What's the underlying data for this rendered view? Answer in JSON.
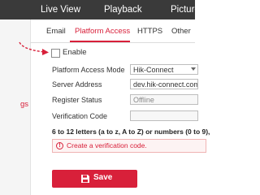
{
  "topbar": {
    "items": [
      "Live View",
      "Playback",
      "Picture"
    ],
    "background": "#3a3a3a"
  },
  "sidebar": {
    "active_item_label": "gs"
  },
  "tabs": {
    "items": [
      "Email",
      "Platform Access",
      "HTTPS",
      "Other"
    ],
    "active": "Platform Access",
    "accent": "#d8203a"
  },
  "enable": {
    "label": "Enable",
    "checked": false
  },
  "form": {
    "platform_access_mode": {
      "label": "Platform Access Mode",
      "value": "Hik-Connect"
    },
    "server_address": {
      "label": "Server Address",
      "value": "dev.hik-connect.com"
    },
    "register_status": {
      "label": "Register Status",
      "value": "Offline"
    },
    "verification_code": {
      "label": "Verification Code",
      "value": ""
    }
  },
  "hint": "6 to 12 letters (a to z, A to Z) or numbers (0 to 9),",
  "error": {
    "icon": "!",
    "message": "Create a verification code."
  },
  "save": {
    "label": "Save"
  }
}
